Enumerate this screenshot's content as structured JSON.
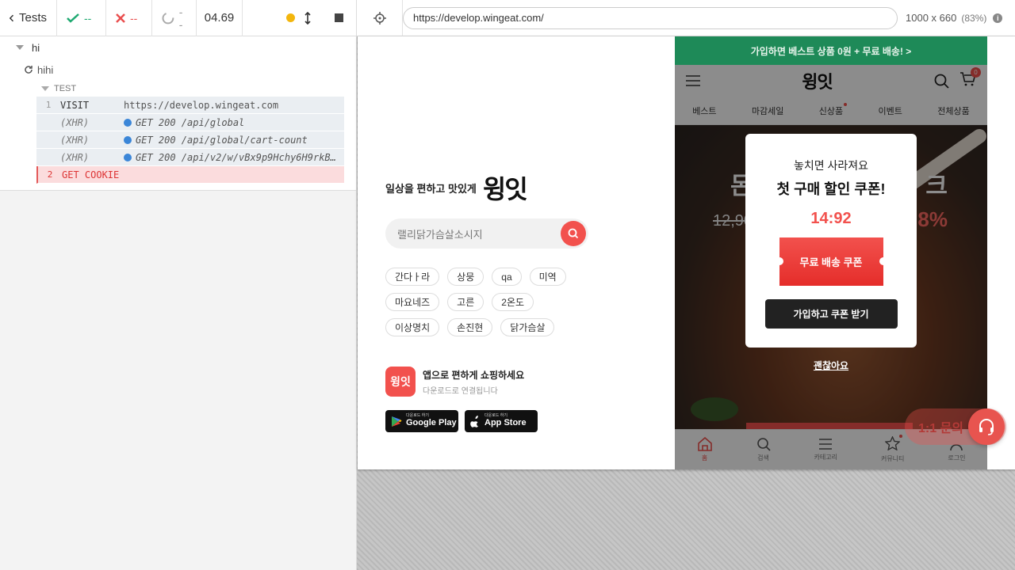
{
  "reporter": {
    "back_label": "Tests",
    "passed": "--",
    "failed": "--",
    "pending": "--",
    "duration": "04.69",
    "suite": "hi",
    "spec": "hihi",
    "test": "TEST",
    "commands": [
      {
        "num": "1",
        "name": "VISIT",
        "msg": "https://develop.wingeat.com"
      },
      {
        "num": "",
        "name": "(XHR)",
        "msg": "GET 200 /api/global"
      },
      {
        "num": "",
        "name": "(XHR)",
        "msg": "GET 200 /api/global/cart-count"
      },
      {
        "num": "",
        "name": "(XHR)",
        "msg": "GET 200 /api/v2/w/vBx9p9Hchy6H9rkB…"
      },
      {
        "num": "2",
        "name": "GET COOKIE",
        "msg": ""
      }
    ]
  },
  "browser": {
    "url": "https://develop.wingeat.com/",
    "viewport": "1000 x 660",
    "scale": "(83%)"
  },
  "landing": {
    "tagline": "일상을 편하고 맛있게",
    "logo": "윙잇",
    "search_placeholder": "랠리닭가슴살소시지",
    "chips": [
      [
        "간다ㅏ라",
        "상뭉",
        "qa",
        "미역"
      ],
      [
        "마요네즈",
        "고른",
        "2온도"
      ],
      [
        "이상명치",
        "손진현",
        "닭가슴살"
      ]
    ],
    "app_promo_title": "앱으로 편하게 쇼핑하세요",
    "app_promo_sub": "다운로드로 연결됩니다",
    "app_icon_text": "윙잇",
    "google_small": "다운로드 하기",
    "google_label": "Google Play",
    "apple_small": "다운로드 하기",
    "apple_label": "App Store"
  },
  "mobile": {
    "banner": "가입하면 베스트 상품 0원 + 무료 배송! >",
    "logo": "윙잇",
    "cart_count": "0",
    "nav": [
      "베스트",
      "마감세일",
      "신상품",
      "이벤트",
      "전체상품"
    ],
    "hero_text_left": "몬",
    "hero_text_right": "크",
    "hero_old_price": "12,90",
    "hero_discount": "8%",
    "tabs": [
      "홈",
      "검색",
      "카테고리",
      "커뮤니티",
      "로그인"
    ]
  },
  "modal": {
    "line1": "놓치면 사라져요",
    "line2": "첫 구매 할인 쿠폰!",
    "timer": "14:92",
    "coupon_label": "무료 배송 쿠폰",
    "get_button": "가입하고 쿠폰 받기",
    "dismiss": "괜찮아요"
  },
  "chat": {
    "label": "1:1 문의"
  },
  "colors": {
    "brand_red": "#f2514d",
    "banner_green": "#1e8a58",
    "pass_green": "#1fa971",
    "fail_red": "#e94f4f",
    "xhr_blue": "#3b86d8"
  }
}
